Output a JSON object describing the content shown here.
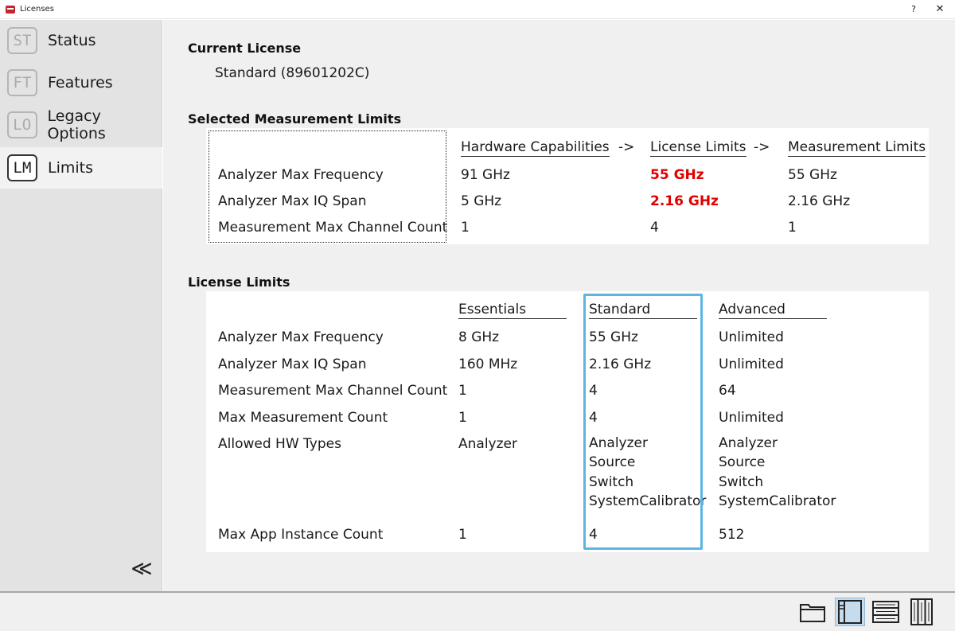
{
  "window": {
    "title": "Licenses",
    "help_label": "?",
    "close_label": "✕"
  },
  "sidebar": {
    "items": [
      {
        "badge": "ST",
        "label": "Status"
      },
      {
        "badge": "FT",
        "label": "Features"
      },
      {
        "badge": "LO",
        "label": "Legacy Options"
      },
      {
        "badge": "LM",
        "label": "Limits"
      }
    ],
    "selected_index": 3,
    "collapse_glyph": "≪"
  },
  "current_license": {
    "title": "Current License",
    "value": "Standard (89601202C)"
  },
  "selected_limits": {
    "title": "Selected Measurement Limits",
    "columns": [
      "Hardware Capabilities",
      "License Limits",
      "Measurement Limits"
    ],
    "arrow": "->",
    "rows": [
      {
        "label": "Analyzer Max Frequency",
        "hardware": "91 GHz",
        "license": "55 GHz",
        "measurement": "55 GHz",
        "license_limiting": true
      },
      {
        "label": "Analyzer Max IQ Span",
        "hardware": "5 GHz",
        "license": "2.16 GHz",
        "measurement": "2.16 GHz",
        "license_limiting": true
      },
      {
        "label": "Measurement Max Channel Count",
        "hardware": "1",
        "license": "4",
        "measurement": "1",
        "license_limiting": false
      }
    ],
    "highlight_color": "#e00000"
  },
  "license_limits": {
    "title": "License Limits",
    "columns": [
      "Essentials",
      "Standard",
      "Advanced"
    ],
    "current_column": "Standard",
    "highlight_color": "#5bb5e6",
    "rows": [
      {
        "label": "Analyzer Max Frequency",
        "values": [
          "8 GHz",
          "55 GHz",
          "Unlimited"
        ]
      },
      {
        "label": "Analyzer Max IQ Span",
        "values": [
          "160 MHz",
          "2.16 GHz",
          "Unlimited"
        ]
      },
      {
        "label": "Measurement Max Channel Count",
        "values": [
          "1",
          "4",
          "64"
        ]
      },
      {
        "label": "Max Measurement Count",
        "values": [
          "1",
          "4",
          "Unlimited"
        ]
      },
      {
        "label": "Allowed HW Types",
        "values": [
          "Analyzer",
          "Analyzer\nSource\nSwitch\nSystemCalibrator",
          "Analyzer\nSource\nSwitch\nSystemCalibrator"
        ]
      },
      {
        "label": "Max App Instance Count",
        "values": [
          "1",
          "4",
          "512"
        ]
      }
    ]
  },
  "bottom_bar": {
    "view_buttons": [
      {
        "icon": "window-layout-icon",
        "active": false
      },
      {
        "icon": "sidebar-layout-icon",
        "active": true
      },
      {
        "icon": "rows-layout-icon",
        "active": false
      },
      {
        "icon": "columns-layout-icon",
        "active": false
      }
    ]
  }
}
